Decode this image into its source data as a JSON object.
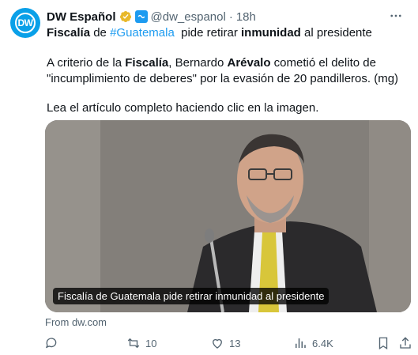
{
  "author": {
    "name": "DW Español",
    "handle": "@dw_espanol",
    "separator": "·",
    "time": "18h",
    "avatar_text": "DW"
  },
  "tweet": {
    "line1": {
      "p1": "Fiscalía",
      "p2": " de ",
      "p3": "#Guatemala",
      "p4": "  pide retirar ",
      "p5": "inmunidad",
      "p6": " al presidente"
    },
    "line2": {
      "p1": "A criterio de la ",
      "p2": "Fiscalía",
      "p3": ", Bernardo ",
      "p4": "Arévalo",
      "p5": " cometió el delito de"
    },
    "line3": "\"incumplimiento de deberes\" por la evasión de 20 pandilleros. (mg)",
    "line4": "Lea el artículo completo haciendo clic en la imagen."
  },
  "card": {
    "caption": "Fiscalía de Guatemala pide retirar inmunidad al presidente",
    "source": "From dw.com"
  },
  "actions": {
    "retweets": "10",
    "likes": "13",
    "views": "6.4K"
  },
  "colors": {
    "accent": "#1d9bf0",
    "muted": "#536471",
    "text": "#0f1419",
    "brand": "#0aa0e8",
    "verified_gold": "#e8b829"
  }
}
